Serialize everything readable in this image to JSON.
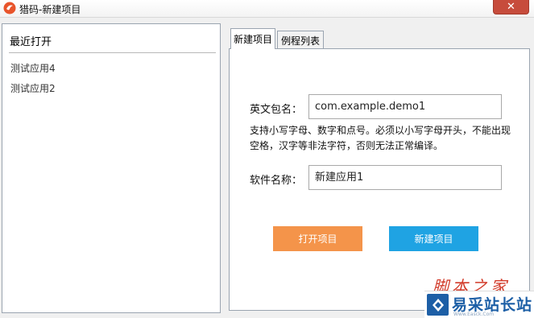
{
  "window": {
    "title": "猎码-新建项目",
    "close_glyph": "✕"
  },
  "recent": {
    "header": "最近打开",
    "items": [
      "测试应用4",
      "测试应用2"
    ]
  },
  "tabs": [
    {
      "label": "新建项目",
      "active": true
    },
    {
      "label": "例程列表",
      "active": false
    }
  ],
  "form": {
    "package_label": "英文包名：",
    "package_value": "com.example.demo1",
    "hint": "支持小写字母、数字和点号。必须以小写字母开头，不能出现空格，汉字等非法字符，否则无法正常编译。",
    "app_name_label": "软件名称：",
    "app_name_value": "新建应用1"
  },
  "buttons": {
    "open_project": "打开项目",
    "create_project": "新建项目"
  },
  "watermark": {
    "top_text": "脚本之家",
    "brand_text": "易采站长站",
    "url_text": "Www.Easck.Com"
  },
  "colors": {
    "open_button": "#f4944a",
    "create_button": "#1fa3e3",
    "close_button": "#c74c3c",
    "watermark_brand": "#1d5fa6"
  }
}
